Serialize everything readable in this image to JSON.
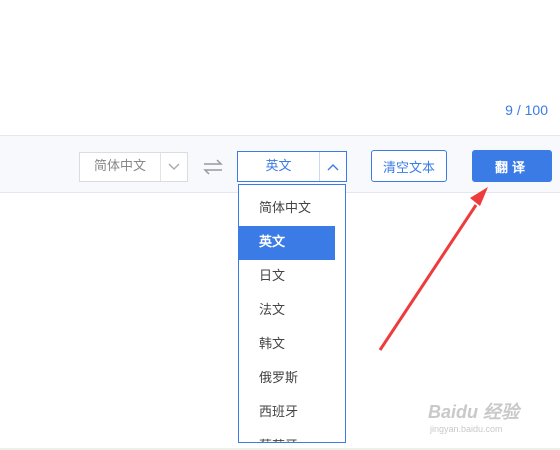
{
  "editor": {
    "char_count": "9 / 100"
  },
  "toolbar": {
    "source_language": "简体中文",
    "target_language": "英文",
    "clear_label": "清空文本",
    "translate_label": "翻译"
  },
  "dropdown": {
    "items": [
      "简体中文",
      "英文",
      "日文",
      "法文",
      "韩文",
      "俄罗斯",
      "西班牙",
      "葡萄牙"
    ],
    "selected": "英文"
  },
  "watermark": {
    "brand": "Baidu 经验",
    "url": "jingyan.baidu.com"
  },
  "colors": {
    "accent": "#3a7be6",
    "annotation_arrow": "#ee3b3b"
  },
  "icons": [
    "chevron-down-icon",
    "swap-arrows-icon",
    "chevron-up-icon"
  ]
}
